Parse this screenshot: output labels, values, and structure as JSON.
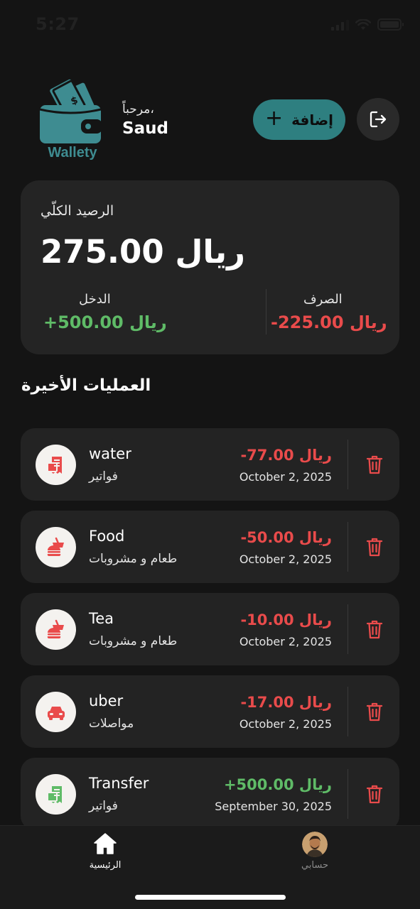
{
  "status": {
    "time": "5:27"
  },
  "header": {
    "logo_text": "Wallety",
    "greeting": "مرحباً،",
    "user_name": "Saud",
    "add_label": "إضافة"
  },
  "balance": {
    "label": "الرصيد الكلّي",
    "amount": "275.00 ريال",
    "income_label": "الدخل",
    "income_value": "+500.00 ريال",
    "spend_label": "الصرف",
    "spend_value": "-225.00 ريال"
  },
  "recent": {
    "title": "العمليات الأخيرة",
    "items": [
      {
        "name": "water",
        "category": "فواتير",
        "amount": "-77.00 ريال",
        "date": "October 2, 2025",
        "type": "expense",
        "icon": "bill-icon",
        "icon_color": "#e94b4b"
      },
      {
        "name": "Food",
        "category": "طعام و مشروبات",
        "amount": "-50.00 ريال",
        "date": "October 2, 2025",
        "type": "expense",
        "icon": "food-icon",
        "icon_color": "#e94b4b"
      },
      {
        "name": "Tea",
        "category": "طعام و مشروبات",
        "amount": "-10.00 ريال",
        "date": "October 2, 2025",
        "type": "expense",
        "icon": "food-icon",
        "icon_color": "#e94b4b"
      },
      {
        "name": "uber",
        "category": "مواصلات",
        "amount": "-17.00 ريال",
        "date": "October 2, 2025",
        "type": "expense",
        "icon": "car-icon",
        "icon_color": "#e94b4b"
      },
      {
        "name": "Transfer",
        "category": "فواتير",
        "amount": "+500.00 ريال",
        "date": "September 30, 2025",
        "type": "income",
        "icon": "bill-icon",
        "icon_color": "#5fbb67"
      }
    ]
  },
  "nav": {
    "home_label": "الرئيسية",
    "profile_label": "حسابي"
  },
  "colors": {
    "accent": "#2e7f80",
    "expense": "#e94b4b",
    "income": "#5fbb67",
    "card": "#232323",
    "background": "#141414"
  }
}
